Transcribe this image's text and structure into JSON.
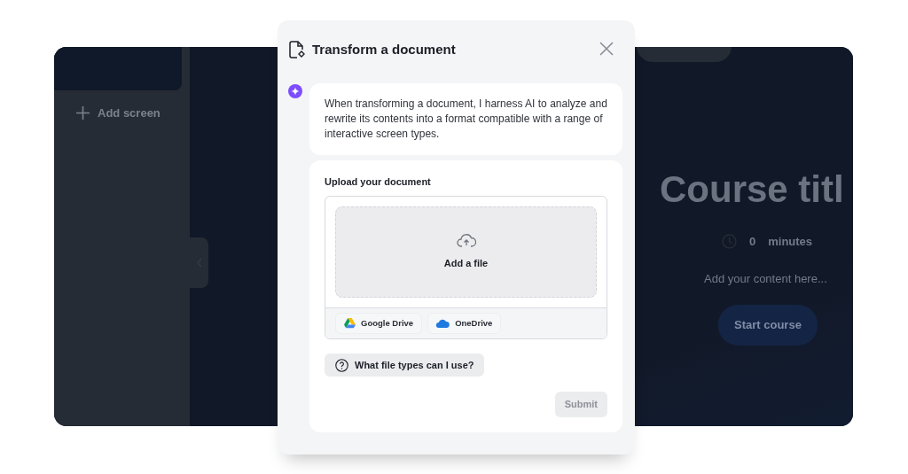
{
  "background_app": {
    "sidebar": {
      "add_screen": "Add screen"
    },
    "preview": {
      "title": "Course titl",
      "duration_value": "0",
      "duration_unit": "minutes",
      "content": "Add your content here...",
      "start_button": "Start course"
    }
  },
  "dialog": {
    "title": "Transform a document",
    "message": "When transforming a document, I harness AI to analyze and rewrite its contents into a format compatible with a range of interactive screen types.",
    "upload": {
      "label": "Upload your document",
      "drop_zone": "Add a file",
      "sources": [
        {
          "label": "Google Drive",
          "kind": "google-drive"
        },
        {
          "label": "OneDrive",
          "kind": "onedrive"
        }
      ]
    },
    "help_button": "What file types can I use?",
    "submit": {
      "label": "Submit",
      "disabled": true
    }
  }
}
